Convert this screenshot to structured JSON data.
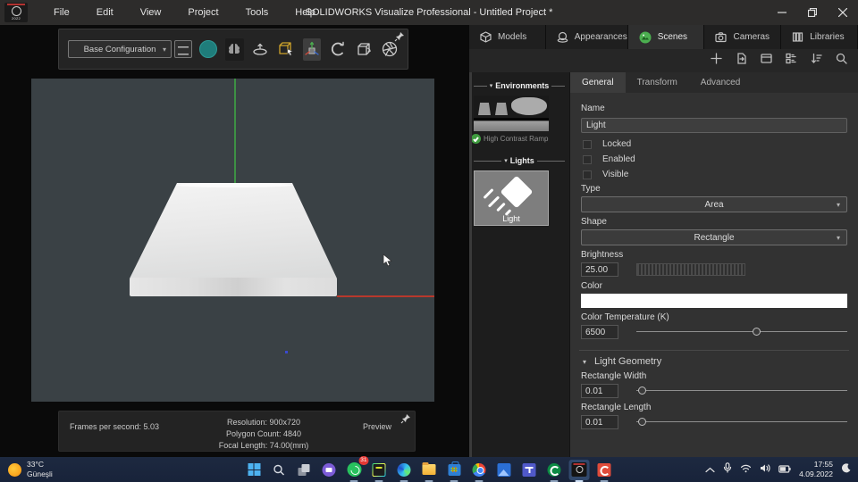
{
  "titlebar": {
    "logo_year": "2022",
    "menus": [
      "File",
      "Edit",
      "View",
      "Project",
      "Tools",
      "Help"
    ],
    "title": "SOLIDWORKS Visualize Professional - Untitled Project *"
  },
  "toolbar": {
    "configuration": "Base Configuration"
  },
  "viewport": {
    "status": {
      "fps": "Frames per second: 5.03",
      "resolution": "Resolution: 900x720",
      "polygons": "Polygon Count: 4840",
      "focal": "Focal Length: 74.00(mm)",
      "mode": "Preview"
    }
  },
  "palette": {
    "tabs": [
      {
        "label": "Models"
      },
      {
        "label": "Appearances"
      },
      {
        "label": "Scenes",
        "active": true
      },
      {
        "label": "Cameras"
      },
      {
        "label": "Libraries"
      }
    ],
    "environments_header": "Environments",
    "environment_name": "High Contrast Ramp",
    "lights_header": "Lights",
    "light_name": "Light"
  },
  "properties": {
    "tabs": [
      "General",
      "Transform",
      "Advanced"
    ],
    "name_label": "Name",
    "name_value": "Light",
    "checkboxes": [
      {
        "label": "Locked",
        "checked": false
      },
      {
        "label": "Enabled",
        "checked": false
      },
      {
        "label": "Visible",
        "checked": false
      }
    ],
    "type_label": "Type",
    "type_value": "Area",
    "shape_label": "Shape",
    "shape_value": "Rectangle",
    "brightness_label": "Brightness",
    "brightness_value": "25.00",
    "color_label": "Color",
    "color_value": "#ffffff",
    "temperature_label": "Color Temperature (K)",
    "temperature_value": "6500",
    "temperature_slider_pct": 56,
    "geometry_header": "Light Geometry",
    "rect_width_label": "Rectangle Width",
    "rect_width_value": "0.01",
    "rect_length_label": "Rectangle Length",
    "rect_length_value": "0.01"
  },
  "taskbar": {
    "weather_temp": "33°C",
    "weather_condition": "Güneşli",
    "whatsapp_badge": "31",
    "clock_time": "17:55",
    "clock_date": "4.09.2022"
  },
  "colors": {
    "viewport_bg": "#3a4145",
    "axis_green": "#3d9044",
    "axis_red": "#b8382c",
    "scenes_tab_green": "#4caf50",
    "teal_render_mode": "#1f7d7b",
    "light_color_swatch": "#ffffff",
    "taskbar_bg": "#1b2539"
  }
}
